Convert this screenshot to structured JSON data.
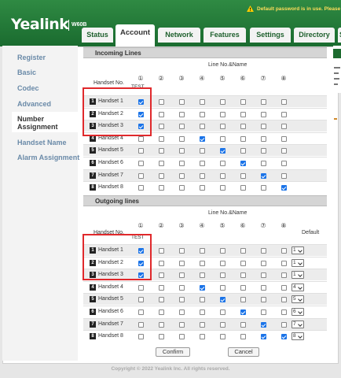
{
  "header": {
    "logo": "Yealink",
    "model": "W60B",
    "warning": "Default password is in use. Please"
  },
  "tabs": [
    "Status",
    "Account",
    "Network",
    "Features",
    "Settings",
    "Directory",
    "S"
  ],
  "active_tab": "Account",
  "sidebar": {
    "items": [
      "Register",
      "Basic",
      "Codec",
      "Advanced",
      "Number Assignment",
      "Handset Name",
      "Alarm Assignment"
    ],
    "active": "Number Assignment"
  },
  "incoming": {
    "title": "Incoming Lines",
    "line_header": "Line No.&Name",
    "handset_header": "Handset No.",
    "test_label": "TEST",
    "rows": [
      {
        "num": "1",
        "name": "Handset 1",
        "checked": [
          1,
          0,
          0,
          0,
          0,
          0,
          0,
          0
        ]
      },
      {
        "num": "2",
        "name": "Handset 2",
        "checked": [
          1,
          0,
          0,
          0,
          0,
          0,
          0,
          0
        ]
      },
      {
        "num": "3",
        "name": "Handset 3",
        "checked": [
          1,
          0,
          0,
          0,
          0,
          0,
          0,
          0
        ]
      },
      {
        "num": "4",
        "name": "Handset 4",
        "checked": [
          0,
          0,
          0,
          1,
          0,
          0,
          0,
          0
        ]
      },
      {
        "num": "5",
        "name": "Handset 5",
        "checked": [
          0,
          0,
          0,
          0,
          1,
          0,
          0,
          0
        ]
      },
      {
        "num": "6",
        "name": "Handset 6",
        "checked": [
          0,
          0,
          0,
          0,
          0,
          1,
          0,
          0
        ]
      },
      {
        "num": "7",
        "name": "Handset 7",
        "checked": [
          0,
          0,
          0,
          0,
          0,
          0,
          1,
          0
        ]
      },
      {
        "num": "8",
        "name": "Handset 8",
        "checked": [
          0,
          0,
          0,
          0,
          0,
          0,
          0,
          1
        ]
      }
    ]
  },
  "outgoing": {
    "title": "Outgoing lines",
    "line_header": "Line No.&Name",
    "handset_header": "Handset No.",
    "test_label": "TEST",
    "default_header": "Default",
    "rows": [
      {
        "num": "1",
        "name": "Handset 1",
        "checked": [
          1,
          0,
          0,
          0,
          0,
          0,
          0,
          0
        ],
        "default": "1"
      },
      {
        "num": "2",
        "name": "Handset 2",
        "checked": [
          1,
          0,
          0,
          0,
          0,
          0,
          0,
          0
        ],
        "default": "1"
      },
      {
        "num": "3",
        "name": "Handset 3",
        "checked": [
          1,
          0,
          0,
          0,
          0,
          0,
          0,
          0
        ],
        "default": "1"
      },
      {
        "num": "4",
        "name": "Handset 4",
        "checked": [
          0,
          0,
          0,
          1,
          0,
          0,
          0,
          0
        ],
        "default": "4"
      },
      {
        "num": "5",
        "name": "Handset 5",
        "checked": [
          0,
          0,
          0,
          0,
          1,
          0,
          0,
          0
        ],
        "default": "5"
      },
      {
        "num": "6",
        "name": "Handset 6",
        "checked": [
          0,
          0,
          0,
          0,
          0,
          1,
          0,
          0
        ],
        "default": "6"
      },
      {
        "num": "7",
        "name": "Handset 7",
        "checked": [
          0,
          0,
          0,
          0,
          0,
          0,
          1,
          0
        ],
        "default": "7"
      },
      {
        "num": "8",
        "name": "Handset 8",
        "checked": [
          0,
          0,
          0,
          0,
          0,
          0,
          1,
          1
        ],
        "default": "8"
      }
    ]
  },
  "line_numbers": [
    "①",
    "②",
    "③",
    "④",
    "⑤",
    "⑥",
    "⑦",
    "⑧"
  ],
  "buttons": {
    "confirm": "Confirm",
    "cancel": "Cancel"
  },
  "footer": "Copyright © 2022 Yealink Inc. All rights reserved.",
  "colors": {
    "header": "#1f7233",
    "checkbox": "#1a73e8",
    "highlight": "#e0292c"
  }
}
